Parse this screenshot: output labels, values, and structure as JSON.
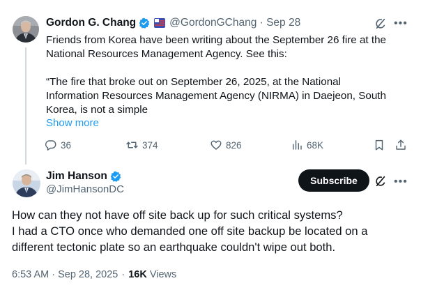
{
  "tweet1": {
    "author_name": "Gordon G. Chang",
    "author_handle": "@GordonGChang · Sep 28",
    "text_lines": [
      "Friends from Korea have been writing about the September 26 fire at the",
      "National Resources Management Agency. See this:",
      "",
      "“The fire that broke out on September 26, 2025, at the National",
      "Information Resources Management Agency (NIRMA) in Daejeon, South",
      "Korea, is not a simple"
    ],
    "show_more": "Show more",
    "replies": "36",
    "reposts": "374",
    "likes": "826",
    "views": "68K"
  },
  "tweet2": {
    "author_name": "Jim Hanson",
    "author_handle": "@JimHansonDC",
    "subscribe_label": "Subscribe",
    "text_lines": [
      "How can they not have off site back up for such critical systems?",
      "I had a CTO once who demanded one off site backup be located on a",
      "different tectonic plate so an earthquake couldn't wipe out both."
    ],
    "timestamp": "6:53 AM · Sep 28, 2025",
    "separator": "·",
    "views_count": "16K",
    "views_label": "Views"
  },
  "icons": {
    "verified": "verified-badge-icon",
    "grok": "grok-icon",
    "more": "more-icon",
    "reply": "reply-icon",
    "repost": "repost-icon",
    "like": "heart-icon",
    "views": "views-chart-icon",
    "bookmark": "bookmark-icon",
    "share": "share-icon"
  },
  "colors": {
    "accent": "#1d9bf0",
    "text": "#0f1419",
    "secondary": "#536471",
    "subscribe_bg": "#0f1419"
  }
}
